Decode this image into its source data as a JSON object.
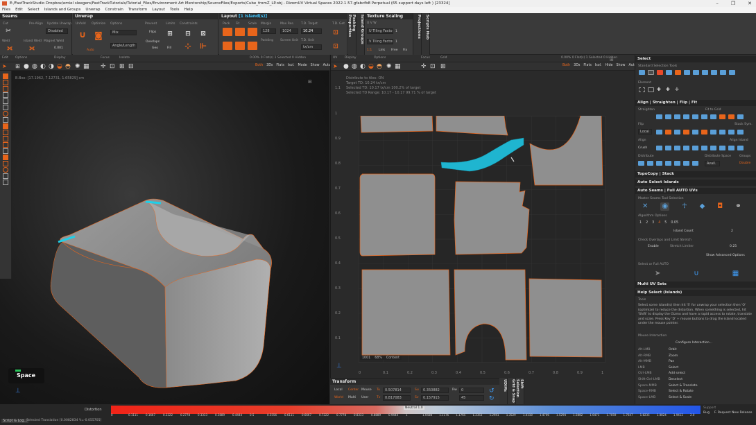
{
  "window": {
    "title": "E:/FastTrackStudio Dropbox/emiel sleegers/FastTrackTutorials/Tutorial_Files/Environment Art Mentorship/SourceFiles/Exports/Cube_fromZ_LP.obj - RizomUV  Virtual Spaces 2022.1.57.gfabcfb8 Perpetual  (65 support days left ) [23324]",
    "controls": [
      "–",
      "❐",
      "✕"
    ]
  },
  "menu": [
    "Files",
    "Edit",
    "Select",
    "Islands and Groups",
    "Unwrap",
    "Constrain",
    "Transform",
    "Layout",
    "Tools",
    "Help"
  ],
  "seams": {
    "title": "Seams",
    "cut": "Cut",
    "pre_align": "Pre-Align",
    "update_unwrap": "Update Unwrap",
    "disabled": "Disabled",
    "weld": "Weld",
    "island_weld": "Island Weld",
    "magnet_weld": "Magnet Weld",
    "val": "0.001"
  },
  "unwrap": {
    "title": "Unwrap",
    "unfold": "Unfold",
    "optimize": "Optimize",
    "options": "Options",
    "auto": "Auto",
    "mix": "Mix",
    "angle_length": "Angle/Length",
    "prevent": "Prevent",
    "flips": "Flips",
    "overlaps": "Overlaps",
    "limits": "Limits",
    "constraints": "Constraints",
    "fill": "Fill",
    "geo": "Geo"
  },
  "layout": {
    "title": "Layout",
    "sel": "[1 island(s)]",
    "pack": "Pack",
    "fit": "Fit",
    "scale": "Scale",
    "margin": "Margin",
    "max_res": "Max Res.",
    "td_target": "T.D. Target",
    "td_get": "T.D. Get",
    "padding": "Padding",
    "screen_unit": "Screen Unit",
    "td_unit": "T.D. Unit",
    "margin_val": "128",
    "td_val": "10.24",
    "res_val": "1024",
    "tdunit_val": "tx/cm"
  },
  "texture_scaling": {
    "title": "Texture Scaling",
    "uvw": "U V W",
    "u_tiling": "U Tiling Factor",
    "v_tiling": "V Tiling Factor",
    "u_val": "1",
    "v_val": "1",
    "one": "1:1",
    "link": "Link",
    "free": "Free",
    "fix": "Fix"
  },
  "vtabs": [
    "Packing Properties",
    "Island Groups",
    "Projections",
    "Scripts Hub"
  ],
  "vp3d": {
    "edit": "Edit",
    "options": "Options",
    "display": "Display",
    "focus": "Focus",
    "isolate": "Isolate",
    "bbox": "B.Box: [17.1962, 7.12731, 1.65829] cm",
    "counts": "0.00%  0 Flat(s)  1 Selected  0 Hidden",
    "modes": [
      "Both",
      "3Ds",
      "Flats",
      "Isol.",
      "Mode",
      "Show",
      "Auto"
    ],
    "space_label": "Space"
  },
  "vpuv": {
    "uv": "UV",
    "display": "Display",
    "options": "Options",
    "focus": "Focus",
    "grid": "Grid",
    "info": [
      "Distribute to tiles: ON",
      "Target TD: 10.24 tx/cm",
      "Selected TD: 10.17 tx/cm  100.2% of target",
      "Selected TD Range: 10.17 - 10.17  99.71 % of target"
    ],
    "counts": "0.00%  0 Flat(s)  1 Selected  0 Hidden",
    "modes": [
      "Both",
      "3Ds",
      "Flats",
      "Isol.",
      "Hide",
      "Show",
      "Auto"
    ],
    "tile_info": [
      "1001",
      "68%",
      "Content"
    ],
    "ruler_y": [
      "1.1",
      "1",
      "0.9",
      "0.8",
      "0.7",
      "0.6",
      "0.5",
      "0.4",
      "0.3",
      "0.2",
      "0.1"
    ],
    "ruler_x": [
      "0",
      "0.1",
      "0.2",
      "0.3",
      "0.4",
      "0.5",
      "0.6",
      "0.7",
      "0.8",
      "0.9",
      "1"
    ]
  },
  "transform": {
    "title": "Transform",
    "local": "Local",
    "center": "Center",
    "mouse": "Mouse",
    "world": "World",
    "multi": "Multi",
    "user": "User",
    "tu": "Tu",
    "tv": "Tv",
    "su": "Su",
    "sv": "Sv",
    "rw": "Rw",
    "tu_val": "0.507814",
    "tv_val": "0.817083",
    "su_val": "0.350882",
    "sv_val": "0.157915",
    "rw_val": "0",
    "rot_val": "45"
  },
  "sidetabs": [
    "UDIMs",
    "Grid & Snap",
    "Shift Selection"
  ],
  "right": {
    "select": "Select",
    "standard_sel": "Standard Selection Tools",
    "element": "Element",
    "align_title": "Align | Straighten | Flip | Fit",
    "straighten": "Straighten",
    "fit_to_grid": "Fit to Grid",
    "flip": "Flip",
    "local": "Local",
    "stack_sym": "Stack Sym.",
    "align": "Align",
    "align_island": "Align Island",
    "crush": "Crush",
    "distribute": "Distribute",
    "distribute_space": "Distribute Space",
    "avail": "Avail.",
    "groups": "Groups",
    "double": "Double",
    "topocopy": "TopoCopy | Stack",
    "auto_select": "Auto Select Islands",
    "auto_seams": "Auto Seams | Full AUTO UVs",
    "master_seams": "Master Seams Tool Selection",
    "algo_opts": "Algorithm Options",
    "nums": [
      "1",
      "2",
      "3",
      "4",
      "5"
    ],
    "algo_val": "0.05",
    "island_count": "Island Count",
    "island_count_val": "2",
    "check_overlaps": "Check Overlaps and Limit Stretch",
    "enable": "Enable",
    "stretch_limiter": "Stretch Limiter",
    "stretch_val": "0.25",
    "show_adv": "Show Advanced Options",
    "select_full": "Select or Full AUTO",
    "multi_uv": "Multi UV Sets",
    "help": "Help Select (Islands)",
    "tools": "Tools",
    "help_text": [
      "Select some island(s) then hit 'S' for unwrap your selection then 'O'",
      "(optimize) to reduce the distortion. When something is selected, hit",
      "'Shift' to display the Gizmo and have a rapid access to rotate, translate",
      "and scale. Press Key 'D' + mouse buttons to drag the island located",
      "under the mouse pointer."
    ],
    "mouse_interaction": "Mouse Interaction",
    "configure": "Configure Interaction...",
    "bindings": [
      [
        "Alt-LMB",
        "Orbit"
      ],
      [
        "Alt-RMB",
        "Zoom"
      ],
      [
        "Alt-MMB",
        "Pan"
      ],
      [
        "LMB",
        "Select"
      ],
      [
        "Ctrl-LMB",
        "Add select"
      ],
      [
        "Shift-Ctrl-LMB",
        "Deselect"
      ],
      [
        "Space-MMB",
        "Select & Translate"
      ],
      [
        "Space-RMB",
        "Select & Rotate"
      ],
      [
        "Space-LMB",
        "Select & Scale"
      ]
    ]
  },
  "status": {
    "distortion": "Distortion",
    "neutral": "Neutral 1.0",
    "script_log": "Script & Log...",
    "selected": "Selected Translation [0.0082834 V=-0.055705]",
    "ticks": [
      "0",
      "0.1111",
      "0.1667",
      "0.2222",
      "0.2778",
      "0.3333",
      "0.3889",
      "0.4444",
      "0.5",
      "0.5556",
      "0.6111",
      "0.6667",
      "0.7222",
      "0.7778",
      "0.8333",
      "0.8889",
      "0.9444",
      "1"
    ],
    "ticks_right": [
      "1.0",
      "1.0588",
      "1.1176",
      "1.1765",
      "1.2353",
      "1.2941",
      "1.3529",
      "1.4118",
      "1.4706",
      "1.5294",
      "1.5882",
      "1.6471",
      "1.7059",
      "1.7647",
      "1.8235",
      "1.8824",
      "1.9412",
      "2.0"
    ],
    "support": "Support",
    "bug": "Bug",
    "f_request": "F. Request",
    "new_release": "New Release"
  },
  "colors": {
    "accent": "#e8651b",
    "selected": "#1fb5d0",
    "bg": "#2b2b2b"
  }
}
